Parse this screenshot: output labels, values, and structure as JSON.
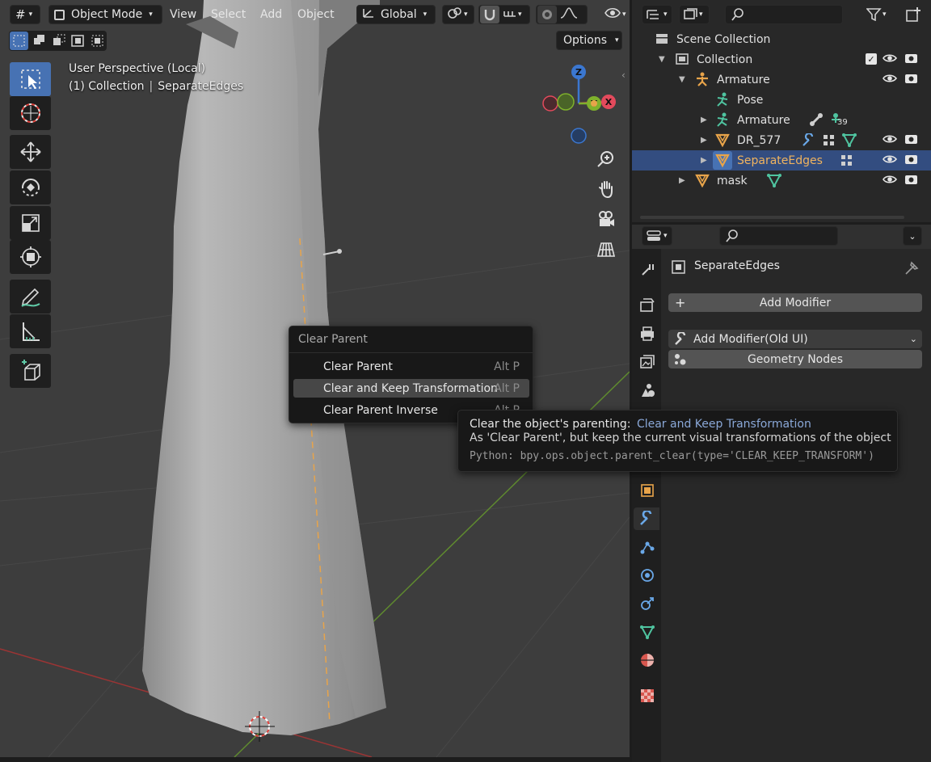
{
  "header": {
    "mode_label": "Object Mode",
    "menus": [
      "View",
      "Select",
      "Add",
      "Object"
    ],
    "orientation_label": "Global",
    "options_label": "Options"
  },
  "viewport": {
    "perspective_label": "User Perspective (Local)",
    "collection_label": "(1) Collection",
    "object_label": "SeparateEdges",
    "gizmo": {
      "x": "X",
      "y": "Y",
      "z": "Z"
    }
  },
  "context_menu": {
    "title": "Clear Parent",
    "items": [
      {
        "label": "Clear Parent",
        "shortcut": "Alt P"
      },
      {
        "label": "Clear and Keep Transformation",
        "shortcut": "Alt P"
      },
      {
        "label": "Clear Parent Inverse",
        "shortcut": "Alt P"
      }
    ]
  },
  "tooltip": {
    "heading": "Clear the object's parenting:",
    "heading_value": "Clear and Keep Transformation",
    "description": "As 'Clear Parent', but keep the current visual transformations of the object",
    "python": "Python: bpy.ops.object.parent_clear(type='CLEAR_KEEP_TRANSFORM')"
  },
  "outliner": {
    "scene_collection": "Scene Collection",
    "collection": "Collection",
    "armature_obj": "Armature",
    "pose": "Pose",
    "armature_data": "Armature",
    "armature_count": "39",
    "dr577": "DR_577",
    "separate_edges": "SeparateEdges",
    "mask": "mask"
  },
  "properties": {
    "object_name": "SeparateEdges",
    "add_modifier": "Add Modifier",
    "add_modifier_old": "Add Modifier(Old UI)",
    "geometry_nodes": "Geometry Nodes"
  },
  "colors": {
    "accent_blue": "#4772b3",
    "selection": "#334d80",
    "orange": "#e8a44a",
    "tooltip_value": "#8aa8d8",
    "gizmo_x": "#e34a5c",
    "gizmo_y": "#7fb12c",
    "gizmo_z": "#3b77d0"
  }
}
